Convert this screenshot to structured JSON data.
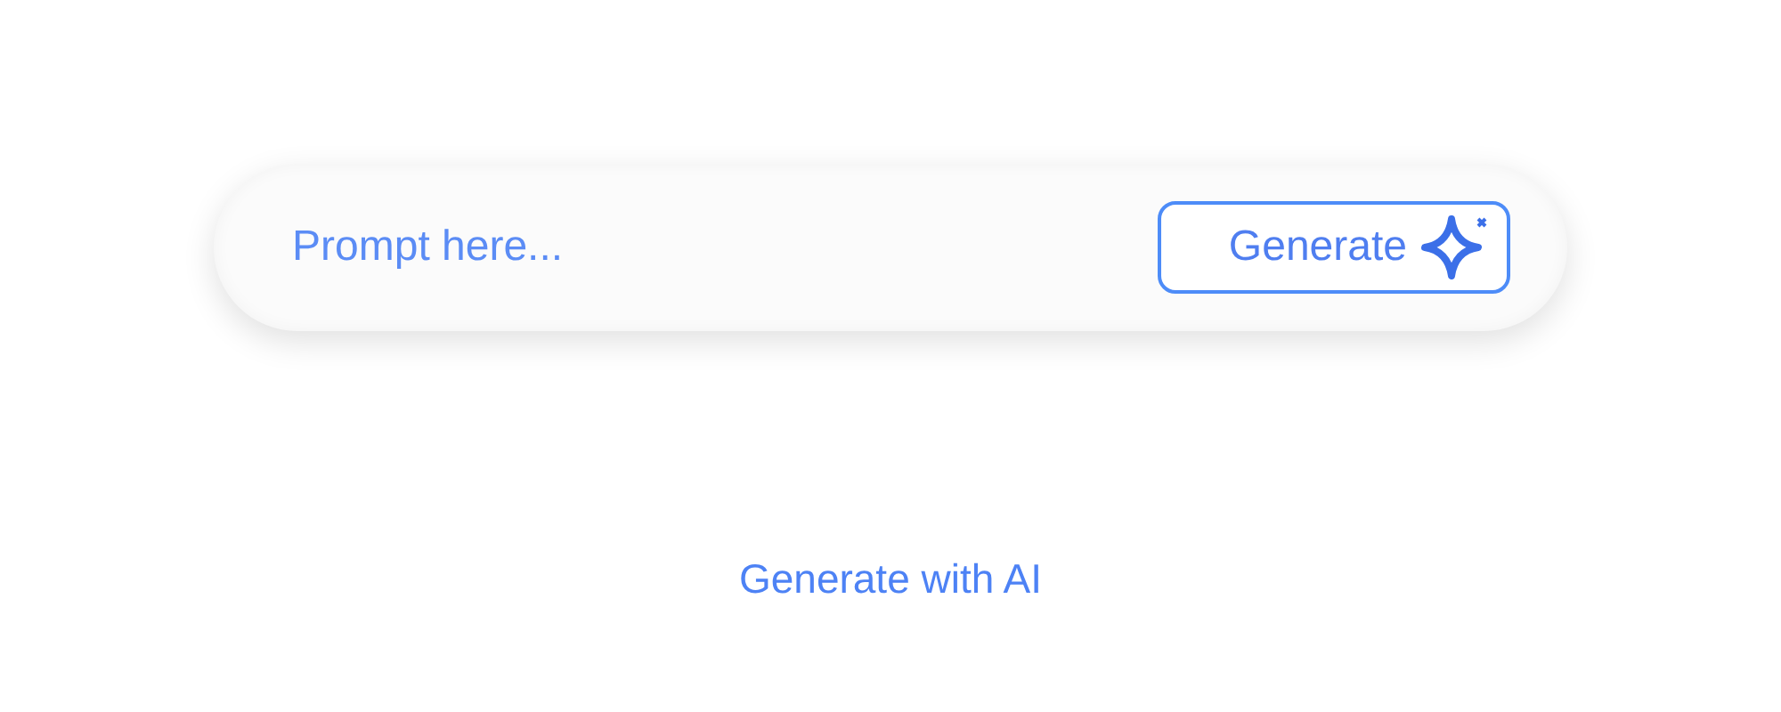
{
  "prompt_bar": {
    "placeholder": "Prompt here...",
    "button": {
      "label": "Generate"
    }
  },
  "caption": "Generate with AI"
}
